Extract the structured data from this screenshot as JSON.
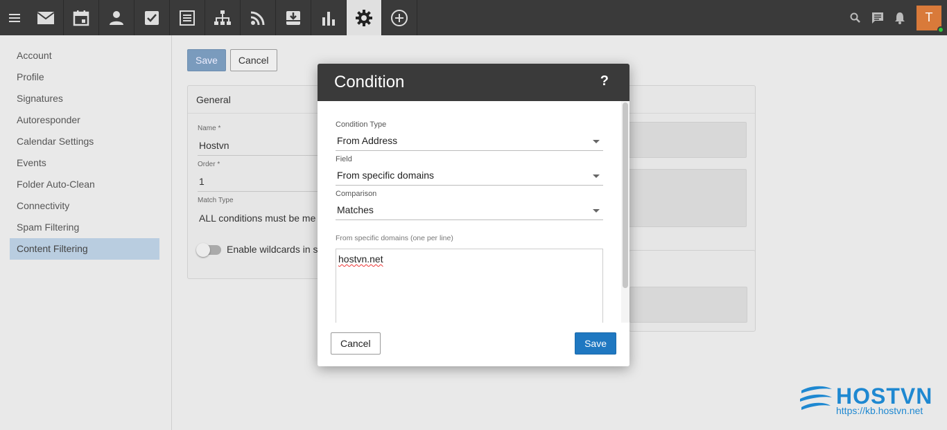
{
  "topbar": {
    "apps": [
      "mail",
      "calendar",
      "contacts",
      "tasks",
      "notes",
      "sitemap",
      "rss",
      "download",
      "reports",
      "settings",
      "add"
    ],
    "active_app": "settings",
    "avatar_initial": "T",
    "presence_color": "#2ecc40"
  },
  "sidebar": {
    "items": [
      {
        "label": "Account"
      },
      {
        "label": "Profile"
      },
      {
        "label": "Signatures"
      },
      {
        "label": "Autoresponder"
      },
      {
        "label": "Calendar Settings"
      },
      {
        "label": "Events"
      },
      {
        "label": "Folder Auto-Clean"
      },
      {
        "label": "Connectivity"
      },
      {
        "label": "Spam Filtering"
      },
      {
        "label": "Content Filtering"
      }
    ],
    "active_index": 9
  },
  "main": {
    "save_label": "Save",
    "cancel_label": "Cancel",
    "general_title": "General",
    "name_label": "Name *",
    "name_value": "Hostvn",
    "order_label": "Order *",
    "order_value": "1",
    "match_type_label": "Match Type",
    "match_type_value": "ALL conditions must be me",
    "wildcards_label": "Enable wildcards in s"
  },
  "modal": {
    "title": "Condition",
    "help": "?",
    "condition_type_label": "Condition Type",
    "condition_type_value": "From Address",
    "field_label": "Field",
    "field_value": "From specific domains",
    "comparison_label": "Comparison",
    "comparison_value": "Matches",
    "domains_label": "From specific domains (one per line)",
    "domains_value": "hostvn.net",
    "cancel_label": "Cancel",
    "save_label": "Save",
    "accent_color": "#1f78c1"
  },
  "watermark": {
    "brand": "HOSTVN",
    "url": "https://kb.hostvn.net"
  }
}
